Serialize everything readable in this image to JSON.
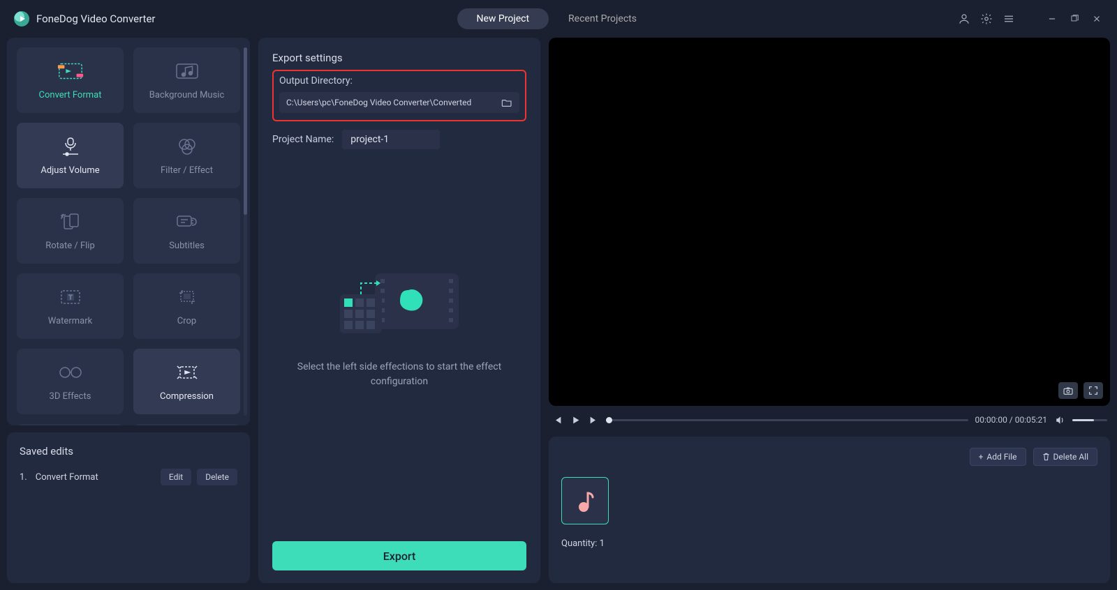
{
  "app": {
    "title": "FoneDog Video Converter"
  },
  "tabs": {
    "new": "New Project",
    "recent": "Recent Projects"
  },
  "effects": [
    {
      "id": "convert-format",
      "label": "Convert Format",
      "variant": "hl"
    },
    {
      "id": "background-music",
      "label": "Background Music",
      "variant": ""
    },
    {
      "id": "adjust-volume",
      "label": "Adjust Volume",
      "variant": "bright"
    },
    {
      "id": "filter-effect",
      "label": "Filter / Effect",
      "variant": ""
    },
    {
      "id": "rotate-flip",
      "label": "Rotate / Flip",
      "variant": ""
    },
    {
      "id": "subtitles",
      "label": "Subtitles",
      "variant": ""
    },
    {
      "id": "watermark",
      "label": "Watermark",
      "variant": ""
    },
    {
      "id": "crop",
      "label": "Crop",
      "variant": ""
    },
    {
      "id": "3d-effects",
      "label": "3D Effects",
      "variant": ""
    },
    {
      "id": "compression",
      "label": "Compression",
      "variant": "bright"
    }
  ],
  "saved": {
    "title": "Saved edits",
    "items": [
      {
        "idx": "1.",
        "name": "Convert Format"
      }
    ],
    "edit_label": "Edit",
    "delete_label": "Delete"
  },
  "export": {
    "settings_title": "Export settings",
    "outdir_label": "Output Directory:",
    "outdir_value": "C:\\Users\\pc\\FoneDog Video Converter\\Converted",
    "proj_label": "Project Name:",
    "proj_value": "project-1",
    "hint": "Select the left side effections to start the effect configuration",
    "export_btn": "Export"
  },
  "playback": {
    "time_current": "00:00:00",
    "time_total": "00:05:21"
  },
  "files": {
    "add_label": "Add File",
    "delete_all_label": "Delete All",
    "quantity_label": "Quantity:",
    "quantity_value": "1"
  }
}
